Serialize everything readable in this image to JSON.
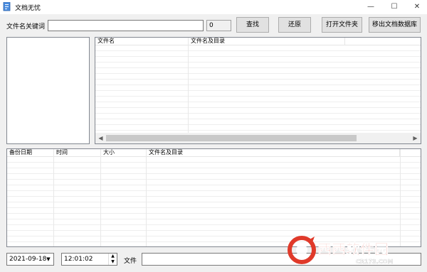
{
  "window": {
    "title": "文档无忧",
    "minimize_glyph": "—",
    "maximize_glyph": "☐",
    "close_glyph": "✕"
  },
  "search": {
    "label": "文件名关键词",
    "value": "",
    "count": "0"
  },
  "buttons": {
    "find": "查找",
    "restore": "还原",
    "open_folder": "打开文件夹",
    "remove_from_db": "移出文档数据库"
  },
  "file_list": {
    "columns": [
      "文件名",
      "文件名及目录"
    ]
  },
  "backup_list": {
    "columns": [
      "备份日期",
      "时间",
      "大小",
      "文件名及目录"
    ]
  },
  "bottom": {
    "date": "2021-09-18",
    "time": "12:01:02",
    "file_label": "文件",
    "file_value": ""
  },
  "watermark": {
    "text": "西西软件园",
    "subtext": "CR173.COM"
  },
  "colors": {
    "accent": "#2b6fd6",
    "watermark_red": "#e03a2a"
  }
}
